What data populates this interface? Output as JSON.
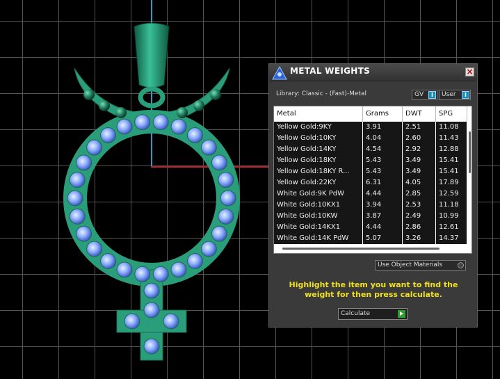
{
  "panel": {
    "title": "METAL WEIGHTS",
    "close_label": "×",
    "library_label": "Library: Classic - (Fast)-Metal",
    "gv_label": "GV",
    "user_label": "User",
    "toggle_indicator": "I",
    "use_object_materials": "Use Object Materials",
    "hint": "Highlight the item you want to find the weight for then press calculate.",
    "calculate_label": "Calculate"
  },
  "table": {
    "columns": [
      "Metal",
      "Grams",
      "DWT",
      "SPG"
    ],
    "rows": [
      [
        "Yellow Gold:9KY",
        "3.91",
        "2.51",
        "11.08"
      ],
      [
        "Yellow Gold:10KY",
        "4.04",
        "2.60",
        "11.43"
      ],
      [
        "Yellow Gold:14KY",
        "4.54",
        "2.92",
        "12.88"
      ],
      [
        "Yellow Gold:18KY",
        "5.43",
        "3.49",
        "15.41"
      ],
      [
        "Yellow Gold:18KY R...",
        "5.43",
        "3.49",
        "15.41"
      ],
      [
        "Yellow Gold:22KY",
        "6.31",
        "4.05",
        "17.89"
      ],
      [
        "White Gold:9K PdW",
        "4.44",
        "2.85",
        "12.59"
      ],
      [
        "White Gold:10KX1",
        "3.94",
        "2.53",
        "11.18"
      ],
      [
        "White Gold:10KW",
        "3.87",
        "2.49",
        "10.99"
      ],
      [
        "White Gold:14KX1",
        "4.44",
        "2.86",
        "12.61"
      ],
      [
        "White Gold:14K PdW",
        "5.07",
        "3.26",
        "14.37"
      ]
    ]
  },
  "colors": {
    "metal_green": "#2a9e7a",
    "gem_blue": "#7fa6ff",
    "hint_yellow": "#f0e020",
    "axis_blue": "#1aa6c8",
    "axis_red": "#c81e1e"
  }
}
